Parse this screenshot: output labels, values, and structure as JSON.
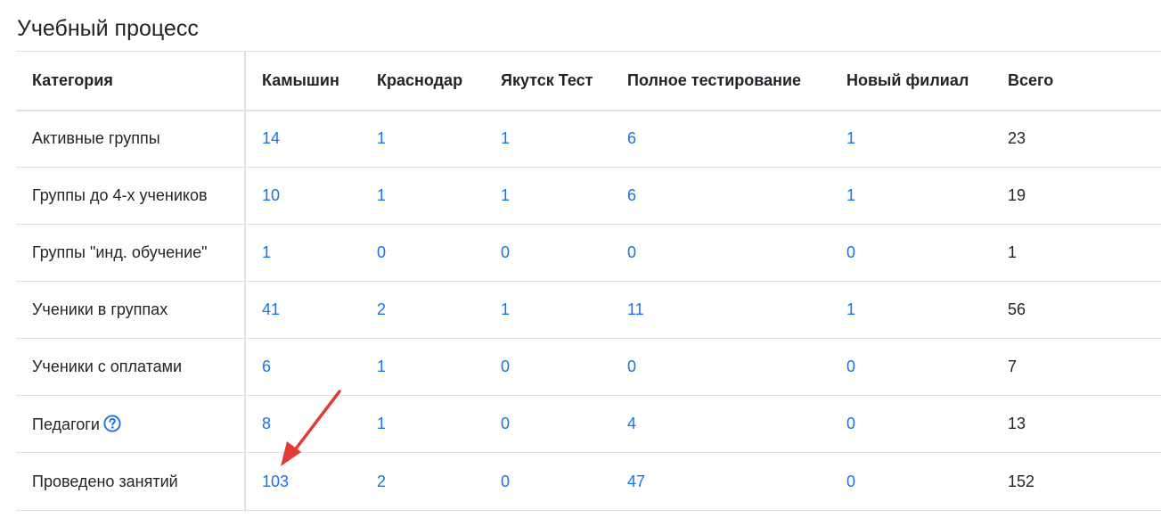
{
  "page": {
    "title": "Учебный процесс"
  },
  "table": {
    "headers": [
      "Категория",
      "Камышин",
      "Краснодар",
      "Якутск Тест",
      "Полное тестирование",
      "Новый филиал",
      "Всего"
    ],
    "rows": [
      {
        "category": "Активные группы",
        "values": [
          "14",
          "1",
          "1",
          "6",
          "1"
        ],
        "total": "23"
      },
      {
        "category": "Группы до 4-х учеников",
        "values": [
          "10",
          "1",
          "1",
          "6",
          "1"
        ],
        "total": "19"
      },
      {
        "category": "Группы \"инд. обучение\"",
        "values": [
          "1",
          "0",
          "0",
          "0",
          "0"
        ],
        "total": "1"
      },
      {
        "category": "Ученики в группах",
        "values": [
          "41",
          "2",
          "1",
          "11",
          "1"
        ],
        "total": "56"
      },
      {
        "category": "Ученики с оплатами",
        "values": [
          "6",
          "1",
          "0",
          "0",
          "0"
        ],
        "total": "7"
      },
      {
        "category": "Педагоги",
        "help_icon": "question-circle-icon",
        "values": [
          "8",
          "1",
          "0",
          "4",
          "0"
        ],
        "total": "13"
      },
      {
        "category": "Проведено занятий",
        "values": [
          "103",
          "2",
          "0",
          "47",
          "0"
        ],
        "total": "152"
      }
    ]
  },
  "colors": {
    "link": "#1a73e8",
    "annotation_arrow": "#e53935",
    "border": "#dee2e6"
  }
}
